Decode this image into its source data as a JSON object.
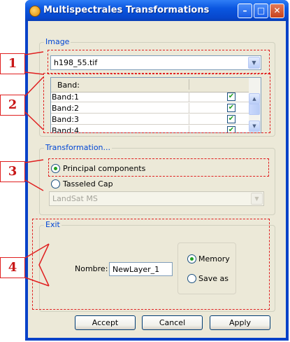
{
  "window": {
    "title": "Multispectrales Transformations",
    "icon": "app-icon",
    "buttons": [
      "minimize-icon",
      "maximize-icon",
      "close-icon"
    ]
  },
  "image_group": {
    "legend": "Image",
    "file_value": "h198_55.tif",
    "band_header": "Band:",
    "bands": [
      {
        "label": "Band:1",
        "checked": true
      },
      {
        "label": "Band:2",
        "checked": true
      },
      {
        "label": "Band:3",
        "checked": true
      },
      {
        "label": "Band:4",
        "checked": true
      }
    ]
  },
  "transformation_group": {
    "legend": "Transformation...",
    "options": [
      {
        "label": "Principal components",
        "selected": true
      },
      {
        "label": "Tasseled Cap",
        "selected": false
      }
    ],
    "sensor_value": "LandSat MS"
  },
  "exit_group": {
    "legend": "Exit",
    "name_label": "Nombre:",
    "name_value": "NewLayer_1",
    "outputs": [
      {
        "label": "Memory",
        "selected": true
      },
      {
        "label": "Save as",
        "selected": false
      }
    ]
  },
  "buttons": {
    "accept": "Accept",
    "cancel": "Cancel",
    "apply": "Apply"
  },
  "callouts": [
    "1",
    "2",
    "3",
    "4"
  ],
  "colors": {
    "annotation": "#e02020",
    "titlebar": "#0a56e0",
    "check": "#21a121"
  }
}
